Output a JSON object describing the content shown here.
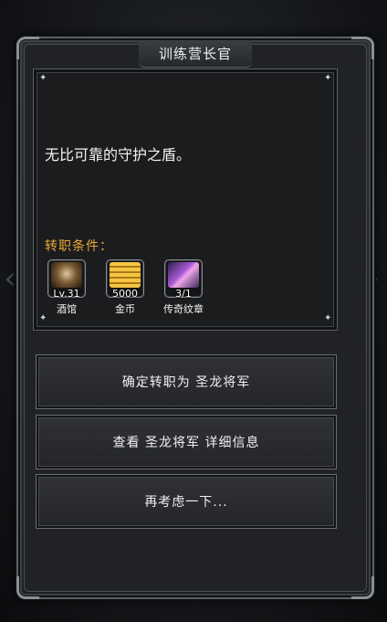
{
  "dialog": {
    "title": "训练营长官",
    "description": "无比可靠的守护之盾。",
    "requirements_label": "转职条件："
  },
  "requirements": [
    {
      "icon": "tavern-mug-icon",
      "count": "Lv.31",
      "name": "酒馆"
    },
    {
      "icon": "gold-coins-icon",
      "count": "5000",
      "name": "金币"
    },
    {
      "icon": "legend-emblem-icon",
      "count": "3/1",
      "name": "传奇纹章"
    }
  ],
  "actions": {
    "confirm": "确定转职为 圣龙将军",
    "details": "查看 圣龙将军 详细信息",
    "reconsider": "再考虑一下..."
  },
  "colors": {
    "requirement_label": "#e9a838",
    "frame_border": "#5d6167"
  }
}
